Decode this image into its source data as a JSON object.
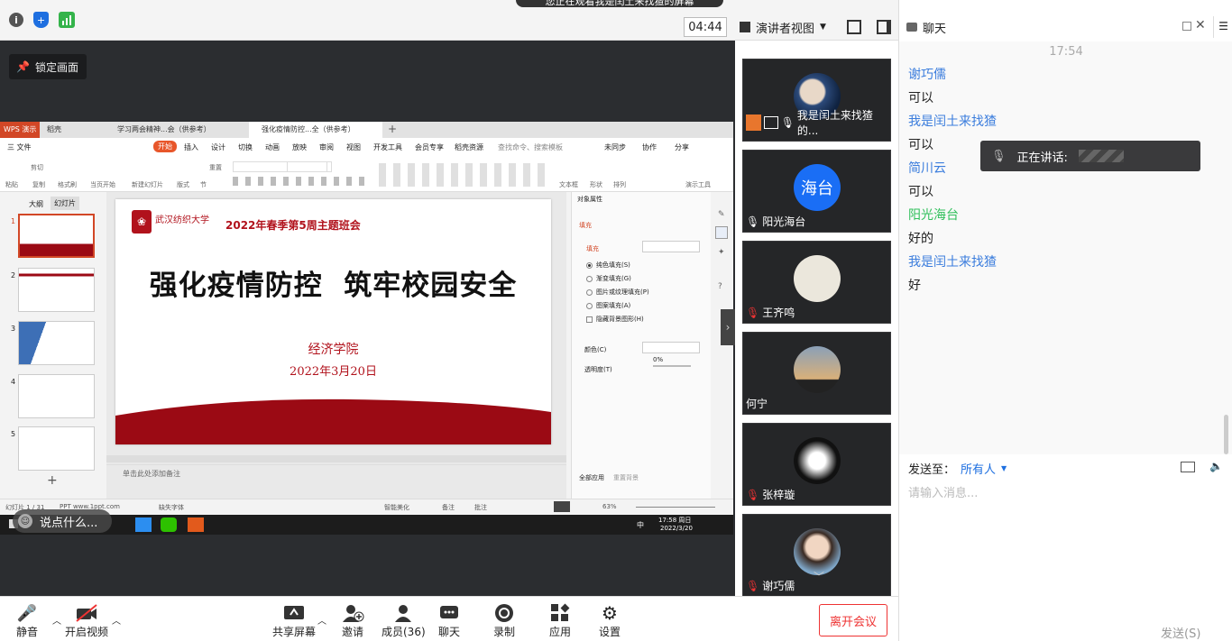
{
  "topbar": {
    "icons": [
      "info-icon",
      "shield-icon",
      "signal-icon"
    ],
    "timer": "04:44",
    "view_label": "演讲者视图",
    "notice": "您正在观看我是闰土来找猹的屏幕"
  },
  "stage": {
    "lock_label": "锁定画面"
  },
  "wps": {
    "tabs": [
      "WPS 演示",
      "稻壳",
      "学习两会精神...会（供参考）",
      "强化疫情防控...全（供参考）"
    ],
    "menu": [
      "三 文件",
      "开始",
      "插入",
      "设计",
      "切换",
      "动画",
      "放映",
      "审阅",
      "视图",
      "开发工具",
      "会员专享",
      "稻壳资源",
      "查找命令、搜索模板",
      "未同步",
      "协作",
      "分享"
    ],
    "ribbon": [
      "粘贴",
      "剪切",
      "复制",
      "格式刷",
      "当页开始",
      "新建幻灯片",
      "版式",
      "节",
      "重置",
      "文本框",
      "形状",
      "排列",
      "演示工具"
    ],
    "panel_tabs": [
      "大纲",
      "幻灯片"
    ],
    "slide_numbers": [
      "1",
      "2",
      "3",
      "4",
      "5"
    ],
    "slide": {
      "header": "2022年春季第5周主题班会",
      "logo_text": "武汉纺织大学",
      "title": "强化疫情防控  筑牢校园安全",
      "college": "经济学院",
      "date": "2022年3月20日"
    },
    "props": {
      "title": "对象属性",
      "tab": "填充",
      "section": "填充",
      "options": [
        "纯色填充(S)",
        "渐变填充(G)",
        "图片或纹理填充(P)",
        "图案填充(A)",
        "隐藏背景图形(H)"
      ],
      "color_label": "颜色(C)",
      "transparency_label": "透明度(T)",
      "transparency_value": "0%",
      "apply_all": "全部应用",
      "reset": "重置背景"
    },
    "notes": "单击此处添加备注",
    "status": {
      "slide_count": "幻灯片 1 / 31",
      "theme": "PPT  www.1ppt.com",
      "font_missing": "缺失字体",
      "beautify": "智能美化",
      "notes_btn": "备注",
      "comments": "批注",
      "zoom": "63%"
    },
    "taskbar": {
      "time": "17:58 周日",
      "date": "2022/3/20",
      "ime": "中"
    },
    "comment_placeholder": "说点什么..."
  },
  "participants": [
    {
      "name": "我是闰土来找猹的..."
    },
    {
      "name": "阳光海台",
      "avatar_text": "海台"
    },
    {
      "name": "王齐鸣"
    },
    {
      "name": "何宁"
    },
    {
      "name": "张梓璇"
    },
    {
      "name": "谢巧儒"
    }
  ],
  "bottombar": {
    "mute": "静音",
    "video": "开启视频",
    "share": "共享屏幕",
    "invite": "邀请",
    "members": "成员(36)",
    "chat": "聊天",
    "record": "录制",
    "apps": "应用",
    "settings": "设置",
    "leave": "离开会议"
  },
  "chat": {
    "title": "聊天",
    "time": "17:54",
    "messages": [
      {
        "name": "谢巧儒",
        "text": "可以",
        "color": "#3b7ddd"
      },
      {
        "name": "我是闰土来找猹",
        "text": "可以",
        "color": "#3b7ddd"
      },
      {
        "name": "简川云",
        "text": "可以",
        "color": "#3b7ddd"
      },
      {
        "name": "阳光海台",
        "text": "好的",
        "color": "#2fbf5a"
      },
      {
        "name": "我是闰土来找猹",
        "text": "好",
        "color": "#3b7ddd"
      }
    ],
    "speaking_label": "正在讲话:",
    "send_to_label": "发送至：",
    "send_to_value": "所有人",
    "input_placeholder": "请输入消息...",
    "send_button": "发送(S)"
  }
}
